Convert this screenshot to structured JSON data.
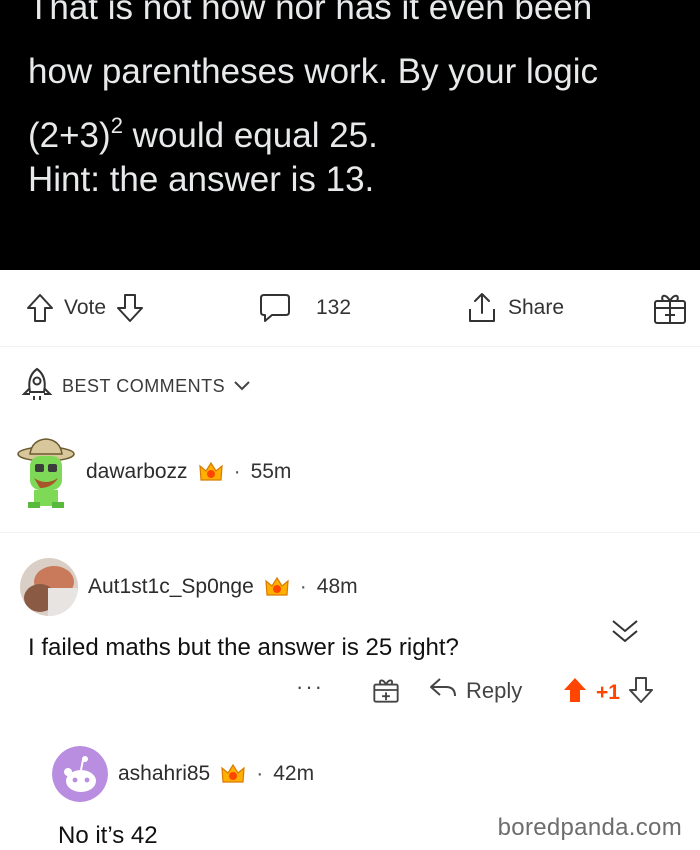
{
  "tweet": {
    "line1": "That is not how nor has it even been",
    "line2": "how parentheses work. By your logic",
    "line3_pre": "(2+3)",
    "line3_sup": "2",
    "line3_post": " would equal 25.",
    "line4": "Hint: the answer is 13."
  },
  "post_actions": {
    "vote_label": "Vote",
    "comments_count": "132",
    "share_label": "Share"
  },
  "sort": {
    "label": "BEST COMMENTS"
  },
  "comments": [
    {
      "username": "dawarbozz",
      "separator": "·",
      "time": "55m"
    },
    {
      "username": "Aut1st1c_Sp0nge",
      "separator": "·",
      "time": "48m",
      "body": "I failed maths but the answer is 25 right?",
      "actions": {
        "more": "···",
        "reply_label": "Reply",
        "score": "+1"
      }
    },
    {
      "username": "ashahri85",
      "separator": "·",
      "time": "42m",
      "body": "No it’s 42"
    }
  ],
  "watermark": "boredpanda.com",
  "colors": {
    "upvote": "#ff4500",
    "background_dark": "#000000",
    "text_light": "#e7e9ea"
  },
  "icons": [
    "arrow-up-icon",
    "arrow-down-icon",
    "comment-bubble-icon",
    "share-icon",
    "award-icon",
    "rocket-sort-icon",
    "chevron-down-icon",
    "collapse-chevron-icon",
    "gift-icon",
    "reply-arrow-icon",
    "upvote-filled-icon",
    "downvote-icon"
  ]
}
